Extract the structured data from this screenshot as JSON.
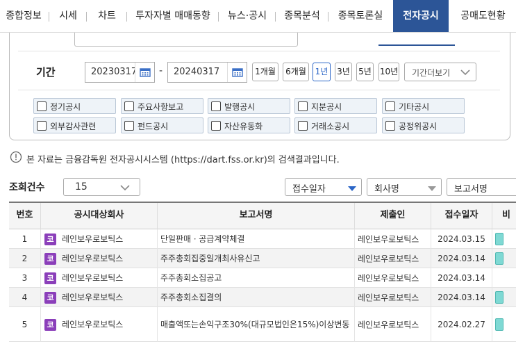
{
  "nav": {
    "tabs": [
      {
        "label": "종합정보"
      },
      {
        "label": "시세"
      },
      {
        "label": "차트"
      },
      {
        "label": "투자자별 매매동향"
      },
      {
        "label": "뉴스·공시"
      },
      {
        "label": "종목분석"
      },
      {
        "label": "종목토론실"
      },
      {
        "label": "전자공시"
      },
      {
        "label": "공매도현황"
      }
    ],
    "active_index": 7
  },
  "search": {
    "period_label": "기간",
    "date_from": "20230317",
    "date_to": "20240317",
    "date_separator": "-",
    "period_buttons": [
      "1개월",
      "6개월",
      "1년",
      "3년",
      "5년",
      "10년"
    ],
    "active_period": "1년",
    "period_more": "기간더보기",
    "checkboxes_row1": [
      "정기공시",
      "주요사항보고",
      "발행공시",
      "지분공시",
      "기타공시"
    ],
    "checkboxes_row2": [
      "외부감사관련",
      "펀드공시",
      "자산유동화",
      "거래소공시",
      "공정위공시"
    ]
  },
  "notice": "본 자료는 금융감독원 전자공시시스템 (https://dart.fss.or.kr)의 검색결과입니다.",
  "listing": {
    "count_label": "조회건수",
    "count_value": "15",
    "sort_options": [
      "접수일자",
      "회사명",
      "보고서명"
    ]
  },
  "table": {
    "headers": [
      "번호",
      "공시대상회사",
      "보고서명",
      "제출인",
      "접수일자",
      "비"
    ],
    "badge_label": "코",
    "rows": [
      {
        "no": "1",
        "company": "레인보우로보틱스",
        "report": "단일판매ㆍ공급계약체결",
        "submitter": "레인보우로보틱스",
        "date": "2024.03.15",
        "extra": true
      },
      {
        "no": "2",
        "company": "레인보우로보틱스",
        "report": "주주총회집중일개최사유신고",
        "submitter": "레인보우로보틱스",
        "date": "2024.03.14",
        "extra": true
      },
      {
        "no": "3",
        "company": "레인보우로보틱스",
        "report": "주주총회소집공고",
        "submitter": "레인보우로보틱스",
        "date": "2024.03.14",
        "extra": false
      },
      {
        "no": "4",
        "company": "레인보우로보틱스",
        "report": "주주총회소집결의",
        "submitter": "레인보우로보틱스",
        "date": "2024.03.14",
        "extra": true
      },
      {
        "no": "5",
        "company": "레인보우로보틱스",
        "report": "매출액또는손익구조30%(대규모법인은15%)이상변동",
        "submitter": "레인보우로보틱스",
        "date": "2024.02.27",
        "extra": true
      }
    ]
  },
  "colors": {
    "active_tab_bg": "#2c5597",
    "badge": "#8b3fba",
    "active_period": "#2c66c7",
    "extra_icon": "#7fd9d4"
  }
}
